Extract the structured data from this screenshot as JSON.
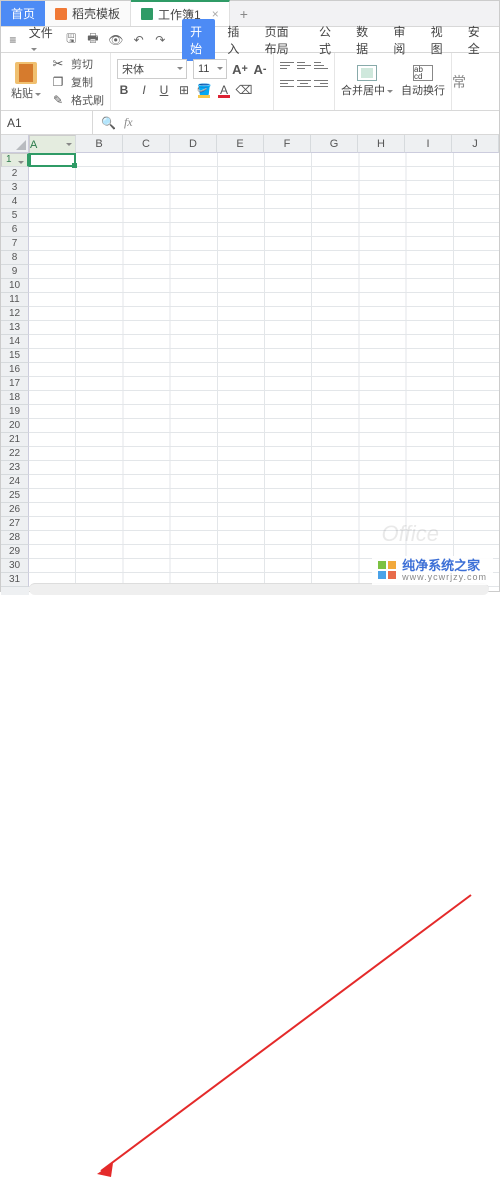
{
  "tabs": {
    "home": "首页",
    "tpl": "稻壳模板",
    "doc": "工作簿1",
    "add": "+"
  },
  "filebar": {
    "menu": "文件"
  },
  "menutabs": {
    "start": "开始",
    "insert": "插入",
    "layout": "页面布局",
    "formula": "公式",
    "data": "数据",
    "review": "审阅",
    "view": "视图",
    "security": "安全"
  },
  "ribbon": {
    "paste": "粘贴",
    "cut": "剪切",
    "copy": "复制",
    "fmt": "格式刷",
    "font": "宋体",
    "size": "11",
    "merge": "合并居中",
    "wrap": "自动换行",
    "more": "常"
  },
  "cellref": "A1",
  "cols": [
    "A",
    "B",
    "C",
    "D",
    "E",
    "F",
    "G",
    "H",
    "I",
    "J"
  ],
  "rows": [
    "1",
    "2",
    "3",
    "4",
    "5",
    "6",
    "7",
    "8",
    "9",
    "10",
    "11",
    "12",
    "13",
    "14",
    "15",
    "16",
    "17",
    "18",
    "19",
    "20",
    "21",
    "22",
    "23",
    "24",
    "25",
    "26",
    "27",
    "28",
    "29",
    "30",
    "31"
  ],
  "watermark": {
    "line1": "纯净系统之家",
    "line2": "www.ycwrjzy.com"
  },
  "chart_data": {
    "type": "table",
    "active_cell": "A1",
    "columns": [
      "A",
      "B",
      "C",
      "D",
      "E",
      "F",
      "G",
      "H",
      "I",
      "J"
    ],
    "rows": 31,
    "values": []
  }
}
